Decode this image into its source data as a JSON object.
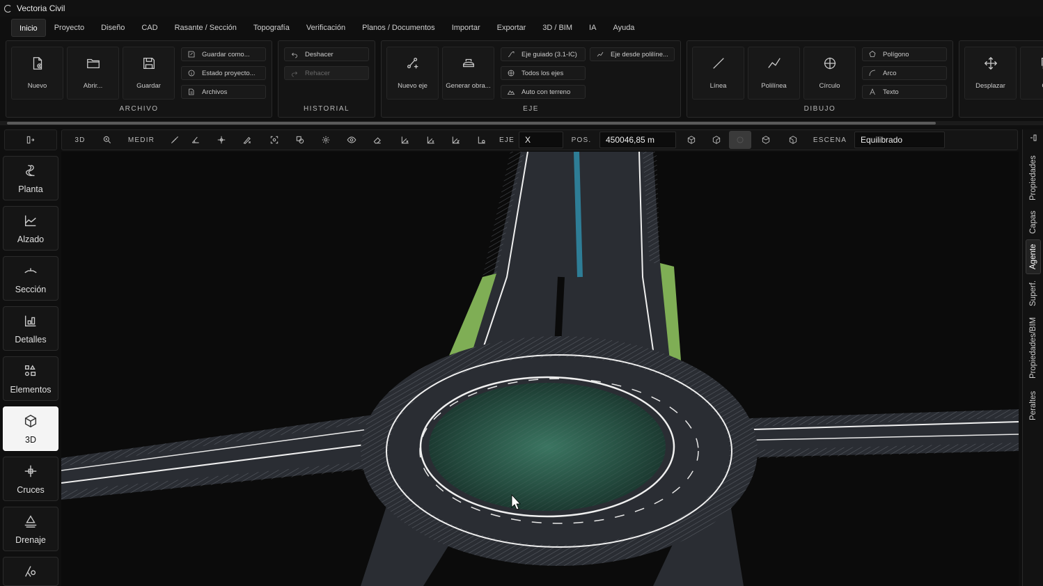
{
  "app": {
    "title": "Vectoria Civil"
  },
  "menu": {
    "tabs": [
      "Inicio",
      "Proyecto",
      "Diseño",
      "CAD",
      "Rasante / Sección",
      "Topografía",
      "Verificación",
      "Planos / Documentos",
      "Importar",
      "Exportar",
      "3D / BIM",
      "IA",
      "Ayuda"
    ],
    "active": "Inicio"
  },
  "ribbon": {
    "archivo": {
      "title": "ARCHIVO",
      "nuevo": "Nuevo",
      "abrir": "Abrir...",
      "guardar": "Guardar",
      "guardar_como": "Guardar como...",
      "estado": "Estado proyecto...",
      "archivos": "Archivos"
    },
    "historial": {
      "title": "HISTORIAL",
      "deshacer": "Deshacer",
      "rehacer": "Rehacer"
    },
    "eje": {
      "title": "EJE",
      "nuevo_eje": "Nuevo eje",
      "generar_obra": "Generar obra...",
      "eje_guiado": "Eje guiado (3.1-IC)",
      "todos": "Todos los ejes",
      "auto_terreno": "Auto con terreno",
      "eje_polilinea": "Eje desde polilíne..."
    },
    "dibujo": {
      "title": "DIBUJO",
      "linea": "Línea",
      "polilinea": "Polilínea",
      "circulo": "Círculo",
      "poligono": "Polígono",
      "arco": "Arco",
      "texto": "Texto"
    },
    "extra": {
      "desplazar": "Desplazar",
      "cut": "Co"
    }
  },
  "viewtoolbar": {
    "mode": "3D",
    "medir": "MEDIR",
    "eje_label": "EJE",
    "eje_value": "X",
    "pos_label": "POS.",
    "pos_value": "450046,85 m",
    "escena_label": "ESCENA",
    "escena_value": "Equilibrado"
  },
  "sidebar": {
    "items": [
      {
        "label": "Planta",
        "icon": "planta-icon"
      },
      {
        "label": "Alzado",
        "icon": "alzado-icon"
      },
      {
        "label": "Sección",
        "icon": "seccion-icon"
      },
      {
        "label": "Detalles",
        "icon": "detalles-icon"
      },
      {
        "label": "Elementos",
        "icon": "elementos-icon"
      },
      {
        "label": "3D",
        "icon": "cube-icon"
      },
      {
        "label": "Cruces",
        "icon": "cruces-icon"
      },
      {
        "label": "Drenaje",
        "icon": "drenaje-icon"
      }
    ],
    "active": "3D"
  },
  "rightpanel": {
    "tabs": [
      "Propiedades",
      "Capas",
      "Agente",
      "Superf.",
      "Propiedades/BIM",
      "Peraltes"
    ],
    "active": "Agente"
  },
  "colors": {
    "accent": "#ffffff",
    "road": "#2a2d33",
    "island": "#2f5a48",
    "verge": "#7fae55"
  }
}
